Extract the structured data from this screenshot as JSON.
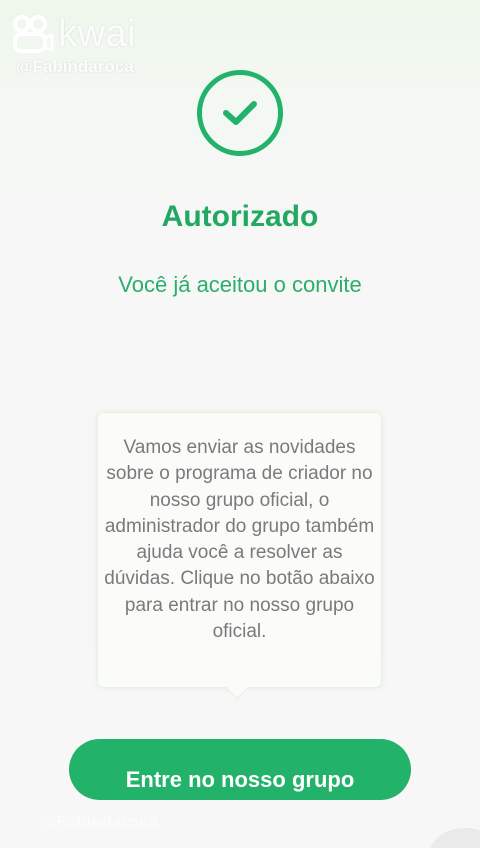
{
  "watermark": {
    "brand": "kwai",
    "handle": "@Fabindaroca"
  },
  "status": {
    "icon": "check-icon",
    "title": "Autorizado",
    "subtitle": "Você já aceitou o convite"
  },
  "info": {
    "text": "Vamos enviar as novidades sobre o programa de criador no nosso grupo oficial, o administrador do grupo também ajuda você a resolver as dúvidas. Clique no botão abaixo para entrar no nosso grupo oficial."
  },
  "actions": {
    "join_label": "Entre no nosso grupo"
  },
  "bottom_watermark": "@Fabindaroca",
  "colors": {
    "accent": "#22b26a",
    "title_green": "#22a862",
    "body_text": "#7a7a7a"
  }
}
